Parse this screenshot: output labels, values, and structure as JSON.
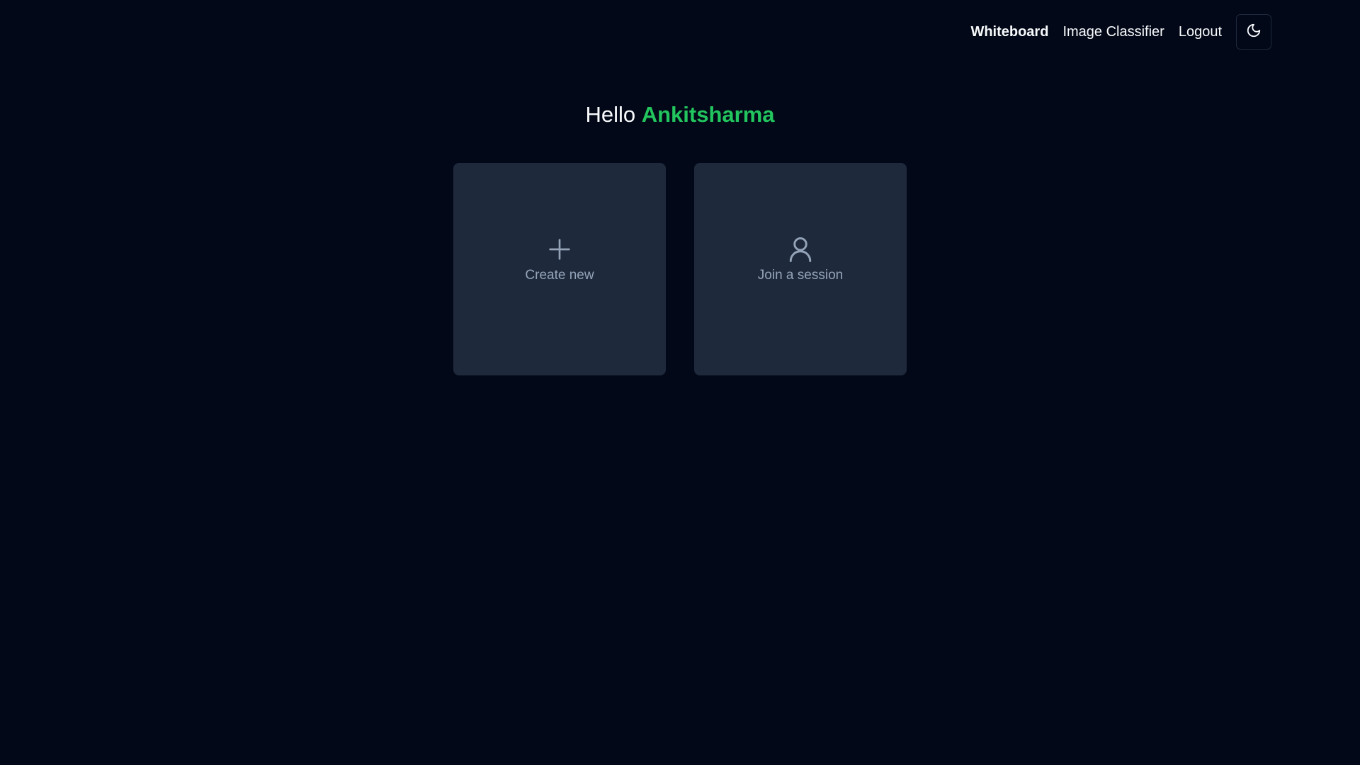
{
  "nav": {
    "links": [
      {
        "label": "Whiteboard",
        "active": true
      },
      {
        "label": "Image Classifier",
        "active": false
      },
      {
        "label": "Logout",
        "active": false
      }
    ],
    "theme_toggle_icon": "moon-icon"
  },
  "greeting": {
    "prefix": "Hello",
    "username": "Ankitsharma"
  },
  "cards": [
    {
      "label": "Create new",
      "icon": "plus-icon"
    },
    {
      "label": "Join a session",
      "icon": "user-icon"
    }
  ],
  "colors": {
    "background": "#020817",
    "card": "#1e293b",
    "accent": "#22c55e",
    "muted_text": "#94a3b8"
  }
}
